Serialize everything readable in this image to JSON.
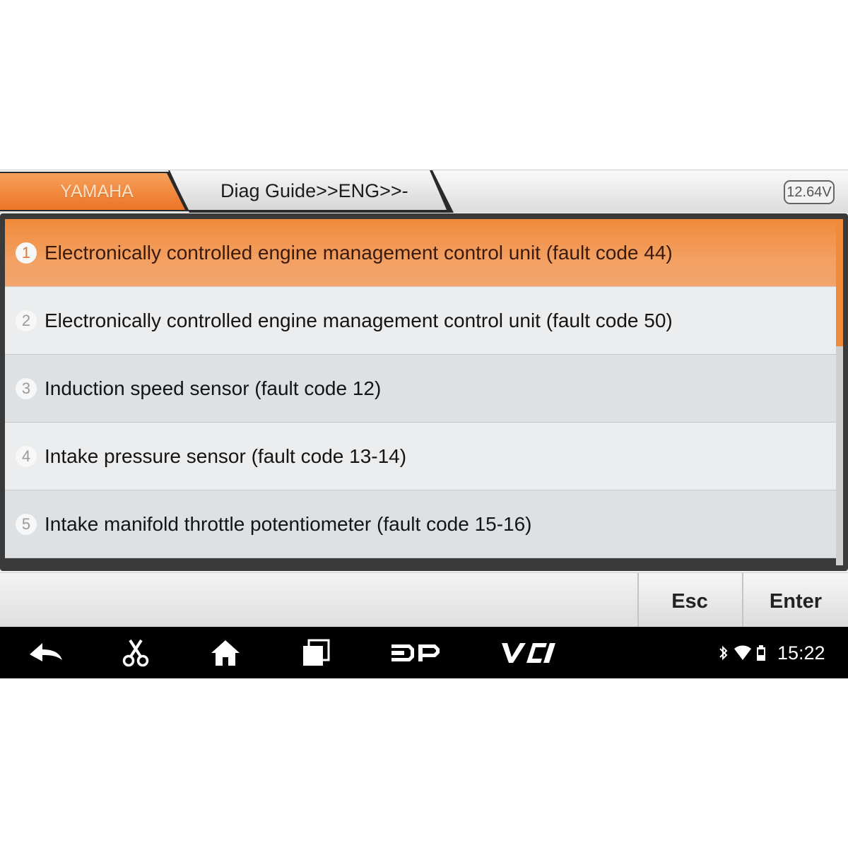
{
  "header": {
    "brand_tab": "YAMAHA",
    "breadcrumb": "Diag Guide>>ENG>>-",
    "battery_voltage": "12.64V"
  },
  "colors": {
    "accent": "#f08a3a",
    "navbar": "#000000"
  },
  "list": {
    "items": [
      {
        "number": "1",
        "label": "Electronically controlled engine management control unit (fault code 44)",
        "selected": true
      },
      {
        "number": "2",
        "label": "Electronically controlled engine management control unit (fault code 50)",
        "selected": false
      },
      {
        "number": "3",
        "label": "Induction speed sensor (fault code 12)",
        "selected": false
      },
      {
        "number": "4",
        "label": "Intake pressure sensor (fault code 13-14)",
        "selected": false
      },
      {
        "number": "5",
        "label": "Intake manifold throttle potentiometer (fault code 15-16)",
        "selected": false
      }
    ]
  },
  "actions": {
    "esc_label": "Esc",
    "enter_label": "Enter"
  },
  "navbar": {
    "icons": [
      "back-icon",
      "scissors-icon",
      "home-icon",
      "recent-apps-icon",
      "dp-icon",
      "vci-icon"
    ],
    "status": {
      "icons": [
        "bluetooth-icon",
        "wifi-icon",
        "battery-icon"
      ],
      "time": "15:22"
    }
  }
}
